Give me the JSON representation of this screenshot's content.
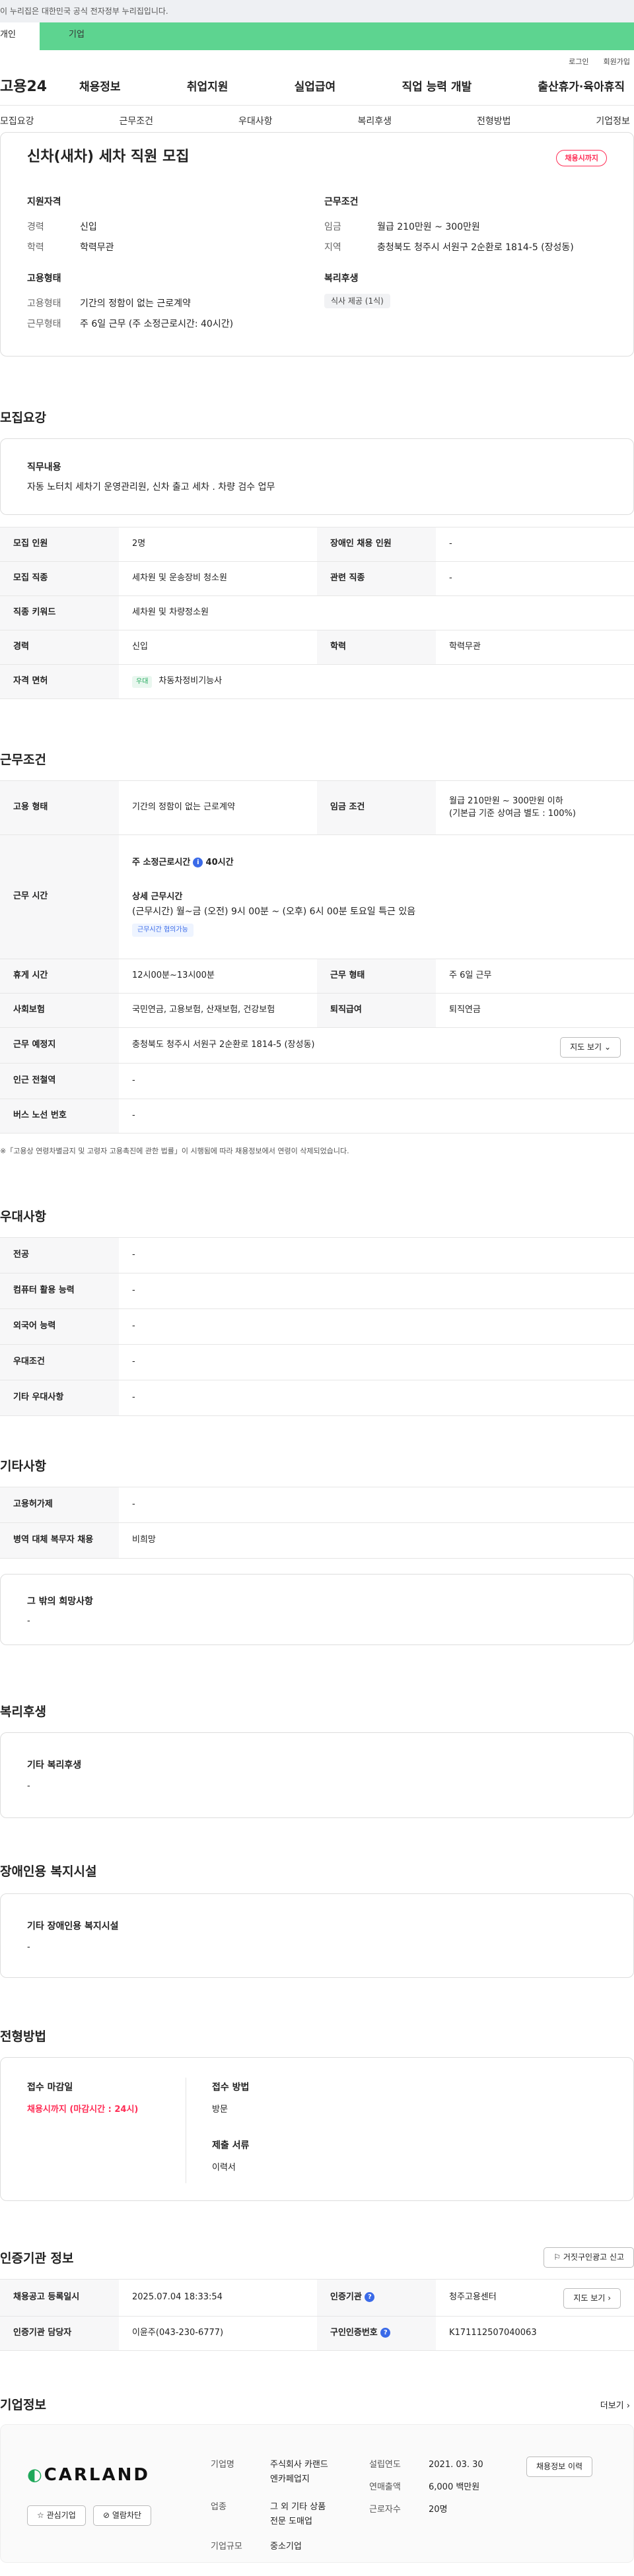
{
  "gov_banner": "이 누리집은 대한민국 공식 전자정부 누리집입니다.",
  "gnb_tabs": [
    "개인",
    "기업"
  ],
  "util": [
    "로그인",
    "회원가입"
  ],
  "logo": "고용24",
  "gnb_menu": [
    "채용정보",
    "취업지원",
    "실업급여",
    "직업 능력 개발",
    "출산휴가·육아휴직"
  ],
  "subnav": [
    "모집요강",
    "근무조건",
    "우대사항",
    "복리후생",
    "전형방법",
    "기업정보"
  ],
  "summary": {
    "title": "신차(새차) 세차 직원 모집",
    "badge": "채용시까지",
    "qual_title": "지원자격",
    "qual": [
      {
        "k": "경력",
        "v": "신입"
      },
      {
        "k": "학력",
        "v": "학력무관"
      }
    ],
    "work_title": "근무조건",
    "work": [
      {
        "k": "임금",
        "v": "월급 210만원 ~ 300만원"
      },
      {
        "k": "지역",
        "v": "충청북도 청주시 서원구 2순환로 1814-5 (장성동)"
      }
    ],
    "emp_title": "고용형태",
    "emp": [
      {
        "k": "고용형태",
        "v": "기간의 정함이 없는 근로계약"
      },
      {
        "k": "근무형태",
        "v": "주 6일 근무 (주 소정근로시간: 40시간)"
      }
    ],
    "welfare_title": "복리후생",
    "welfare_chip": "식사 제공 (1식)"
  },
  "recruit": {
    "heading": "모집요강",
    "job_title": "직무내용",
    "job_desc": "자동 노터치 세차기 운영관리원, 신차 출고 세차 . 차량 검수 업무",
    "rows": [
      {
        "k1": "모집 인원",
        "v1": "2명",
        "k2": "장애인 채용 인원",
        "v2": "-"
      },
      {
        "k1": "모집 직종",
        "v1": "세차원 및 운송장비 청소원",
        "k2": "관련 직종",
        "v2": "-"
      },
      {
        "k1": "직종 키워드",
        "v1": "세차원 및 차량정소원",
        "k2": "",
        "v2": ""
      },
      {
        "k1": "경력",
        "v1": "신입",
        "k2": "학력",
        "v2": "학력무관"
      },
      {
        "k1": "자격 면허",
        "badge": "우대",
        "v1": "차동차정비기능사",
        "k2": "",
        "v2": ""
      }
    ]
  },
  "conditions": {
    "heading": "근무조건",
    "emp_k": "고용 형태",
    "emp_v": "기간의 정함이 없는 근로계약",
    "wage_k": "임금 조건",
    "wage_v1": "월급 210만원 ~ 300만원 이하",
    "wage_v2": "(기본급 기준 상여금 별도 : 100%)",
    "hours_k": "근무 시간",
    "hours_label": "주 소정근로시간",
    "hours_val": "40시간",
    "hours_detail_title": "상세 근무시간",
    "hours_detail": "(근무시간) 월~금 (오전) 9시 00분 ~ (오후) 6시 00분 토요일 특근 있음",
    "hours_badge": "근무시간 협의가능",
    "break_k": "휴게 시간",
    "break_v": "12시00분~13시00분",
    "type_k": "근무 형태",
    "type_v": "주 6일 근무",
    "ins_k": "사회보험",
    "ins_v": "국민연금, 고용보험, 산재보험, 건강보험",
    "ret_k": "퇴직급여",
    "ret_v": "퇴직연금",
    "place_k": "근무 예정지",
    "place_v": "충청북도 청주시 서원구 2순환로 1814-5 (장성동)",
    "map_btn": "지도 보기",
    "subway_k": "인근 전철역",
    "subway_v": "-",
    "bus_k": "버스 노선 번호",
    "bus_v": "-",
    "note": "※「고용상 연령차별금지 및 고령자 고용촉진에 관한 법률」이 시행됨에 따라 채용정보에서 연령이 삭제되었습니다."
  },
  "prefs": {
    "heading": "우대사항",
    "rows": [
      {
        "k": "전공",
        "v": "-"
      },
      {
        "k": "컴퓨터 활용 능력",
        "v": "-"
      },
      {
        "k": "외국어 능력",
        "v": "-"
      },
      {
        "k": "우대조건",
        "v": "-"
      },
      {
        "k": "기타 우대사항",
        "v": "-"
      }
    ]
  },
  "etc": {
    "heading": "기타사항",
    "rows": [
      {
        "k": "고용허가제",
        "v": "-"
      },
      {
        "k": "병역 대체 복무자 채용",
        "v": "비희망"
      }
    ],
    "other_title": "그 밖의 희망사항",
    "other_v": "-"
  },
  "welfare": {
    "heading": "복리후생",
    "title": "기타 복리후생",
    "v": "-"
  },
  "disability": {
    "heading": "장애인용 복지시설",
    "title": "기타 장애인용 복지시설",
    "v": "-"
  },
  "selection": {
    "heading": "전형방법",
    "deadline_title": "접수 마감일",
    "deadline_v": "채용시까지 (마감시간 : 24시)",
    "method_title": "접수 방법",
    "method_v": "방문",
    "docs_title": "제출 서류",
    "docs_v": "이력서"
  },
  "contact": {
    "heading": "인증기관 정보",
    "report_btn": "거짓구인광고 신고",
    "reg_k": "채용공고 등록일시",
    "reg_v": "2025.07.04 18:33:54",
    "org_k": "인증기관",
    "org_v": "청주고용센터",
    "map_btn": "지도 보기",
    "mgr_k": "인증기관 담당자",
    "mgr_v": "이윤주(043-230-6777)",
    "num_k": "구인인증번호",
    "num_v": "K171112507040063"
  },
  "company": {
    "heading": "기업정보",
    "more": "더보기",
    "logo_text": "CARLAND",
    "fav_btn": "관심기업",
    "block_btn": "열람차단",
    "name_k": "기업명",
    "name_v1": "주식회사 카랜드",
    "name_v2": "엔카페업지",
    "biz_k": "업종",
    "biz_v1": "그 외 기타 상품",
    "biz_v2": "전문 도매업",
    "size_k": "기업규모",
    "size_v": "중소기업",
    "year_k": "설립연도",
    "year_v": "2021. 03. 30",
    "sales_k": "연매출액",
    "sales_v": "6,000 백만원",
    "staff_k": "근로자수",
    "staff_v": "20명",
    "detail_btn": "채용정보 이력"
  },
  "colors": {
    "accent_green": "#5dd490",
    "accent_red": "#ff2d55",
    "accent_blue": "#3a6ae8"
  }
}
